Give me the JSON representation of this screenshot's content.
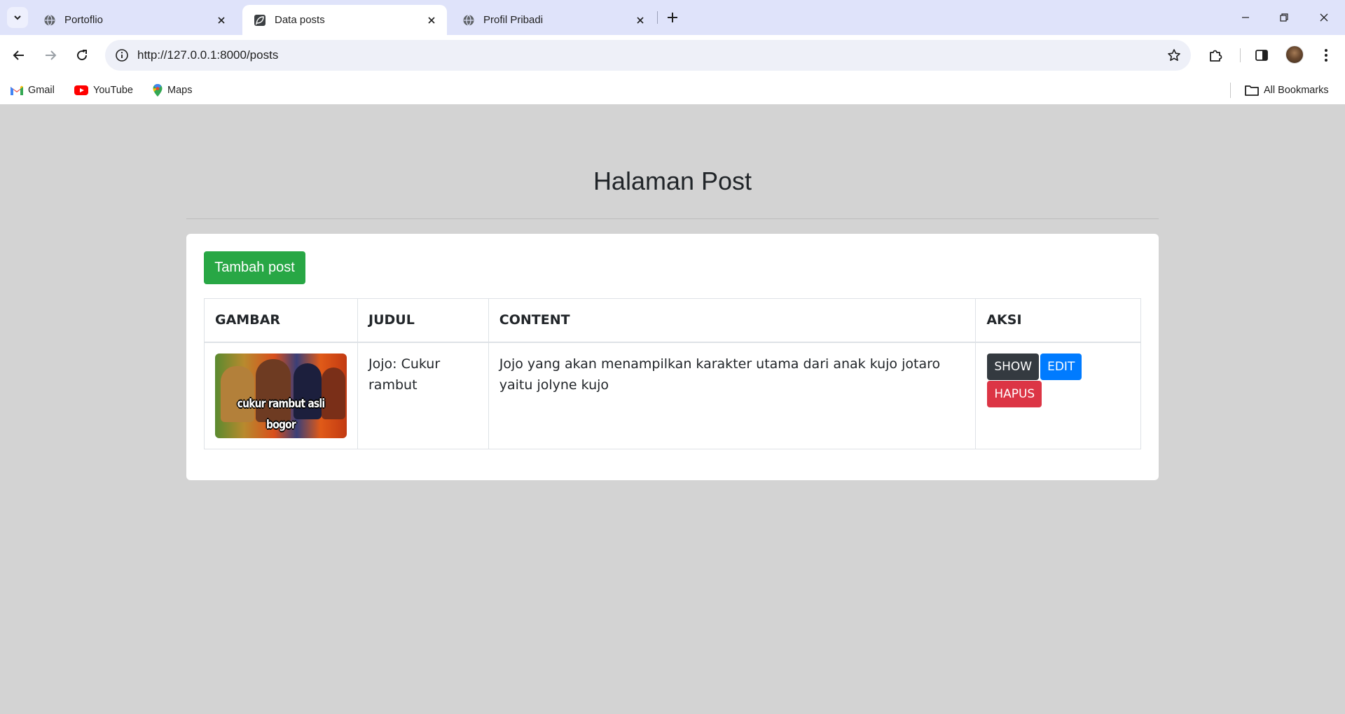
{
  "browser": {
    "tabs": [
      {
        "title": "Portoflio",
        "active": false,
        "icon": "globe-icon"
      },
      {
        "title": "Data posts",
        "active": true,
        "icon": "leaf-icon"
      },
      {
        "title": "Profil Pribadi",
        "active": false,
        "icon": "globe-icon"
      }
    ],
    "url": "http://127.0.0.1:8000/posts",
    "bookmarks": [
      {
        "label": "Gmail",
        "icon": "gmail-icon"
      },
      {
        "label": "YouTube",
        "icon": "youtube-icon"
      },
      {
        "label": "Maps",
        "icon": "maps-icon"
      }
    ],
    "all_bookmarks_label": "All Bookmarks"
  },
  "page": {
    "title": "Halaman Post",
    "add_button": "Tambah post",
    "table": {
      "headers": [
        "GAMBAR",
        "JUDUL",
        "CONTENT",
        "AKSI"
      ],
      "rows": [
        {
          "image_caption": "cukur rambut asli bogor",
          "judul": "Jojo: Cukur rambut",
          "content": "Jojo yang akan menampilkan karakter utama dari anak kujo jotaro yaitu jolyne kujo",
          "actions": {
            "show": "SHOW",
            "edit": "EDIT",
            "delete": "HAPUS"
          }
        }
      ]
    }
  },
  "colors": {
    "success": "#28a745",
    "primary": "#007bff",
    "dark": "#343a40",
    "danger": "#dc3545",
    "page_bg": "#d3d3d3"
  }
}
